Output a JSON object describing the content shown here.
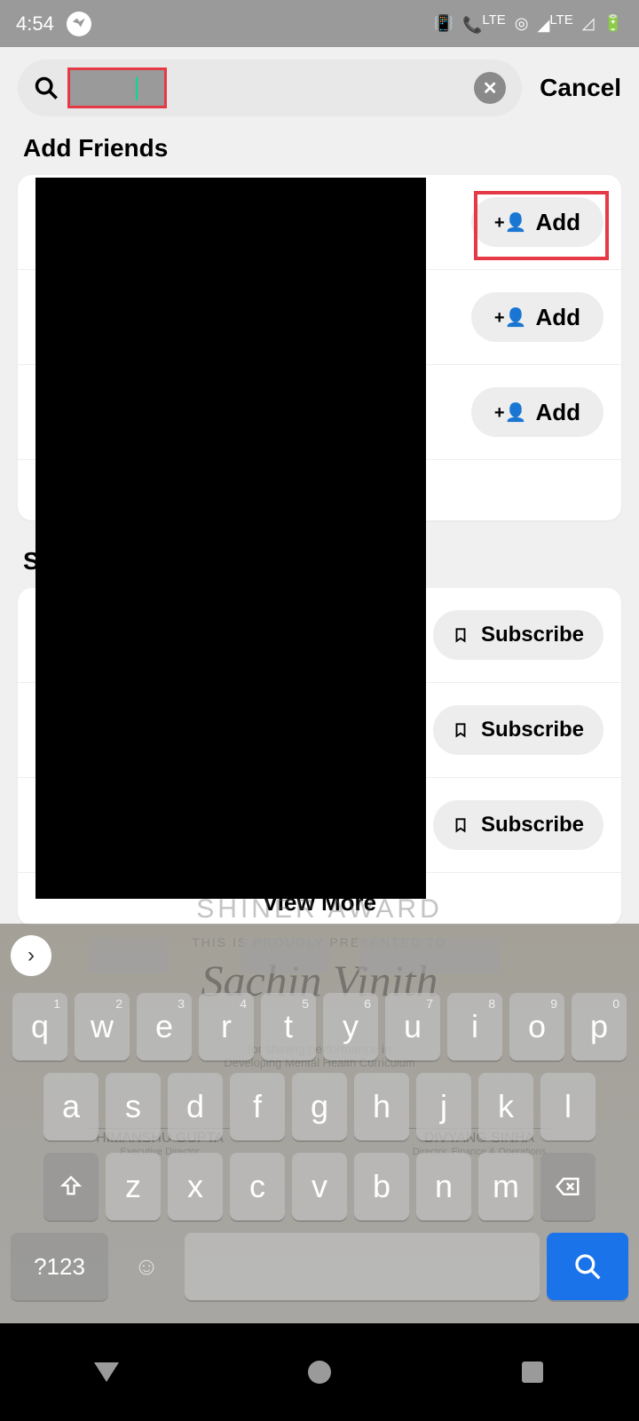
{
  "status": {
    "time": "4:54",
    "lte": "LTE",
    "lte2": "LTE"
  },
  "search": {
    "placeholder": "",
    "value": "",
    "cancel": "Cancel"
  },
  "sections": {
    "add_friends_title": "Add Friends",
    "second_title_visible": "S",
    "view_more": "View More"
  },
  "buttons": {
    "add": "Add",
    "subscribe": "Subscribe"
  },
  "keyboard": {
    "row1": [
      "q",
      "w",
      "e",
      "r",
      "t",
      "y",
      "u",
      "i",
      "o",
      "p"
    ],
    "row1_sup": [
      "1",
      "2",
      "3",
      "4",
      "5",
      "6",
      "7",
      "8",
      "9",
      "0"
    ],
    "row2": [
      "a",
      "s",
      "d",
      "f",
      "g",
      "h",
      "j",
      "k",
      "l"
    ],
    "row3": [
      "z",
      "x",
      "c",
      "v",
      "b",
      "n",
      "m"
    ],
    "sym": "?123"
  },
  "bg_award": {
    "title": "SHINER AWARD",
    "subtitle": "THIS IS PROUDLY PRESENTED TO",
    "name": "Sachin Vinith",
    "line1": "for shining performance in",
    "line2": "Developing Mental Health Curriculum",
    "sig1_name": "HIMANSHU GUPTA",
    "sig1_role": "Executive Director",
    "sig2_name": "DIVYANG SINHA",
    "sig2_role": "Director, Finance & Operations"
  }
}
